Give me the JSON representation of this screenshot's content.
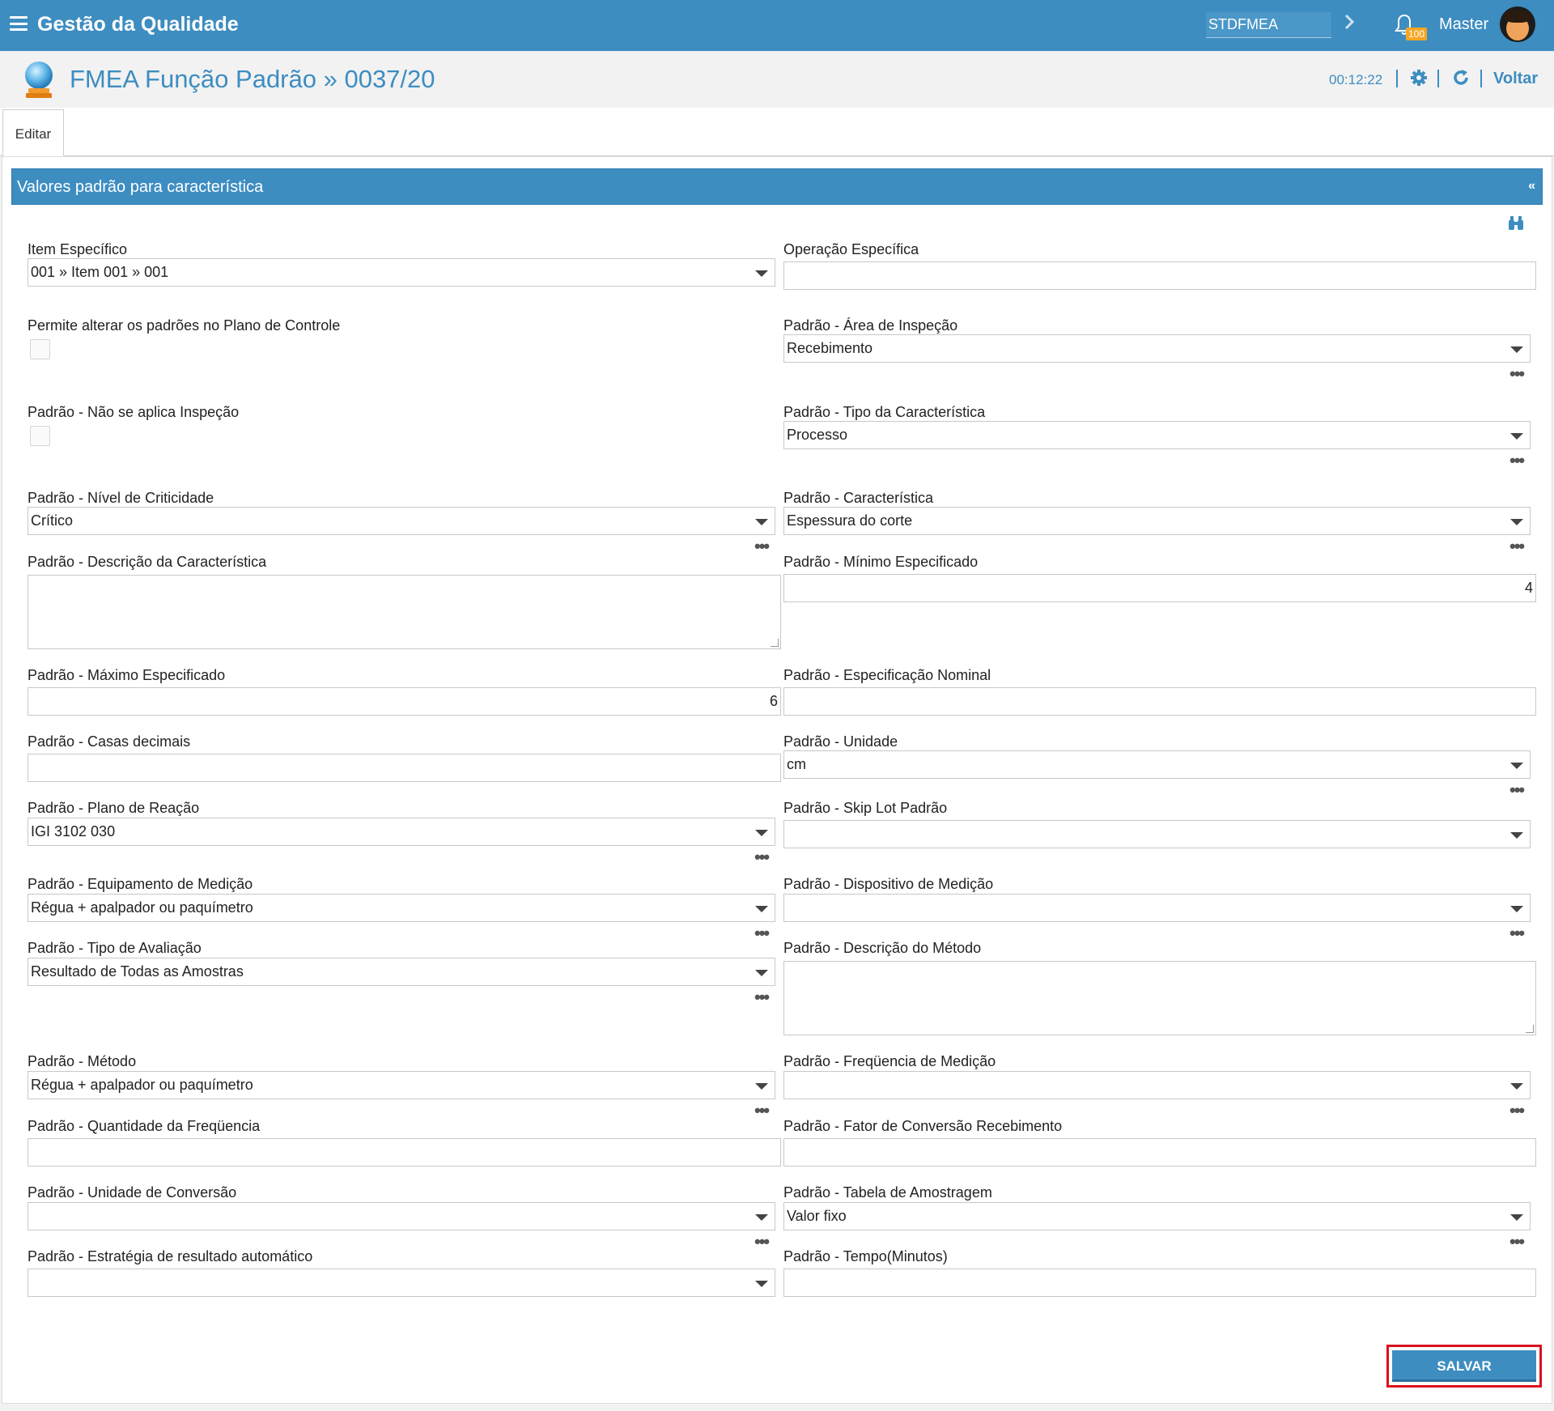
{
  "topbar": {
    "app_title": "Gestão da Qualidade",
    "database": "STDFMEA",
    "notification_count": "100",
    "user": "Master"
  },
  "header": {
    "title": "FMEA Função Padrão » 0037/20",
    "timer": "00:12:22",
    "back_label": "Voltar"
  },
  "tabs": [
    {
      "label": "Editar"
    }
  ],
  "section": {
    "title": "Valores padrão para característica",
    "collapse": "«"
  },
  "fields": {
    "item_especifico": {
      "label": "Item Específico",
      "value": "001 » Item 001 » 001"
    },
    "operacao_especifica": {
      "label": "Operação Específica",
      "value": ""
    },
    "permite_alterar": {
      "label": "Permite alterar os padrões no Plano de Controle"
    },
    "area_inspecao": {
      "label": "Padrão - Área de Inspeção",
      "value": "Recebimento"
    },
    "nao_aplica_inspecao": {
      "label": "Padrão - Não se aplica Inspeção"
    },
    "tipo_caracteristica": {
      "label": "Padrão - Tipo da Característica",
      "value": "Processo"
    },
    "nivel_criticidade": {
      "label": "Padrão - Nível de Criticidade",
      "value": "Crítico"
    },
    "caracteristica": {
      "label": "Padrão - Característica",
      "value": "Espessura do corte"
    },
    "descricao_caracteristica": {
      "label": "Padrão - Descrição da Característica",
      "value": ""
    },
    "minimo_especificado": {
      "label": "Padrão - Mínimo Especificado",
      "value": "4"
    },
    "maximo_especificado": {
      "label": "Padrão - Máximo Especificado",
      "value": "6"
    },
    "especificacao_nominal": {
      "label": "Padrão - Especificação Nominal",
      "value": ""
    },
    "casas_decimais": {
      "label": "Padrão - Casas decimais",
      "value": ""
    },
    "unidade": {
      "label": "Padrão - Unidade",
      "value": "cm"
    },
    "plano_reacao": {
      "label": "Padrão - Plano de Reação",
      "value": "IGI 3102 030"
    },
    "skip_lot": {
      "label": "Padrão - Skip Lot Padrão",
      "value": ""
    },
    "equipamento_medicao": {
      "label": "Padrão - Equipamento de Medição",
      "value": "Régua + apalpador ou paquímetro"
    },
    "dispositivo_medicao": {
      "label": "Padrão - Dispositivo de Medição",
      "value": ""
    },
    "tipo_avaliacao": {
      "label": "Padrão - Tipo de Avaliação",
      "value": "Resultado de Todas as Amostras"
    },
    "descricao_metodo": {
      "label": "Padrão - Descrição do Método",
      "value": ""
    },
    "metodo": {
      "label": "Padrão - Método",
      "value": "Régua + apalpador ou paquímetro"
    },
    "frequencia_medicao": {
      "label": "Padrão - Freqüencia de Medição",
      "value": ""
    },
    "quantidade_frequencia": {
      "label": "Padrão - Quantidade da Freqüencia",
      "value": ""
    },
    "fator_conversao": {
      "label": "Padrão - Fator de Conversão Recebimento",
      "value": ""
    },
    "unidade_conversao": {
      "label": "Padrão - Unidade de Conversão",
      "value": ""
    },
    "tabela_amostragem": {
      "label": "Padrão - Tabela de Amostragem",
      "value": "Valor fixo"
    },
    "estrategia_resultado": {
      "label": "Padrão - Estratégia de resultado automático",
      "value": ""
    },
    "tempo_minutos": {
      "label": "Padrão - Tempo(Minutos)",
      "value": ""
    }
  },
  "save_label": "SALVAR",
  "colors": {
    "primary": "#3d8dc1",
    "highlight": "#d9111d",
    "badge": "#f5a623"
  }
}
